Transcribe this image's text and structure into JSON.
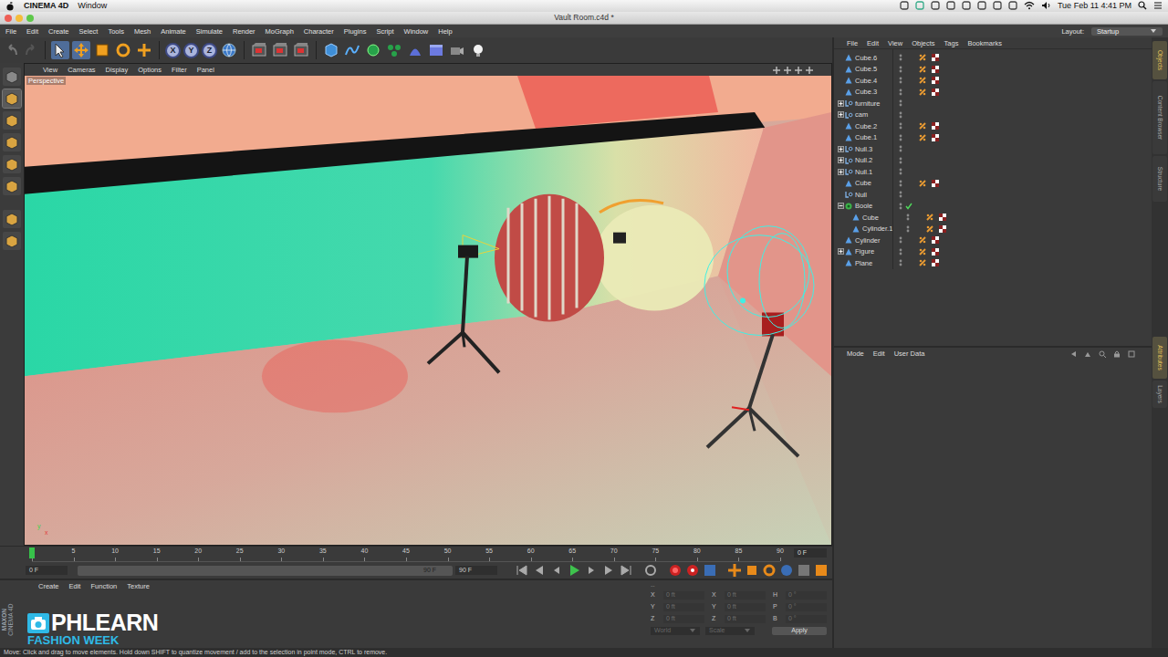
{
  "macbar": {
    "menus": [
      "CINEMA 4D",
      "Window"
    ],
    "clock": "Tue Feb 11  4:41 PM"
  },
  "window": {
    "title": "Vault Room.c4d *"
  },
  "menu": [
    "File",
    "Edit",
    "Create",
    "Select",
    "Tools",
    "Mesh",
    "Animate",
    "Simulate",
    "Render",
    "MoGraph",
    "Character",
    "Plugins",
    "Script",
    "Window",
    "Help"
  ],
  "layout": {
    "label": "Layout:",
    "value": "Startup"
  },
  "toolbar": {
    "tools": [
      {
        "selected": true
      },
      {
        "selected": true
      },
      {
        "selected": false
      },
      {
        "selected": false
      },
      {
        "selected": false
      }
    ],
    "axes": [
      {
        "label": "X",
        "on": true
      },
      {
        "label": "Y",
        "on": true
      },
      {
        "label": "Z",
        "on": true
      }
    ]
  },
  "modes": [
    {
      "selected": false
    },
    {
      "selected": true
    },
    {
      "selected": false
    },
    {
      "selected": false
    },
    {
      "selected": false
    },
    {
      "selected": false
    },
    {
      "selected": false
    },
    {
      "selected": false
    }
  ],
  "viewport": {
    "menu": [
      "View",
      "Cameras",
      "Display",
      "Options",
      "Filter",
      "Panel"
    ],
    "label": "Perspective",
    "axis": [
      "y",
      "x"
    ]
  },
  "timeline": {
    "ticks": [
      "0",
      "5",
      "10",
      "15",
      "20",
      "25",
      "30",
      "35",
      "40",
      "45",
      "50",
      "55",
      "60",
      "65",
      "70",
      "75",
      "80",
      "85",
      "90"
    ],
    "frame": "0 F",
    "playhead": 0
  },
  "transport": {
    "start": "0 F",
    "range_end": "90 F",
    "end": "90 F"
  },
  "materials": {
    "menu": [
      "Create",
      "Edit",
      "Function",
      "Texture"
    ]
  },
  "coordinates": {
    "header": "--",
    "columns": [
      {
        "axes": [
          "X",
          "Y",
          "Z"
        ],
        "values": [
          "0 ft",
          "0 ft",
          "0 ft"
        ]
      },
      {
        "axes": [
          "X",
          "Y",
          "Z"
        ],
        "values": [
          "0 ft",
          "0 ft",
          "0 ft"
        ]
      },
      {
        "axes": [
          "H",
          "P",
          "B"
        ],
        "values": [
          "0 °",
          "0 °",
          "0 °"
        ]
      }
    ],
    "mode": "World",
    "size_mode": "Scale",
    "apply": "Apply"
  },
  "objects": {
    "menu": [
      "File",
      "Edit",
      "View",
      "Objects",
      "Tags",
      "Bookmarks"
    ],
    "items": [
      {
        "name": "Cube.6",
        "kind": "object",
        "depth": 0,
        "expandable": false,
        "expanded": false,
        "checked": false,
        "tags": true
      },
      {
        "name": "Cube.5",
        "kind": "object",
        "depth": 0,
        "expandable": false,
        "expanded": false,
        "checked": false,
        "tags": true
      },
      {
        "name": "Cube.4",
        "kind": "object",
        "depth": 0,
        "expandable": false,
        "expanded": false,
        "checked": false,
        "tags": true
      },
      {
        "name": "Cube.3",
        "kind": "object",
        "depth": 0,
        "expandable": false,
        "expanded": false,
        "checked": false,
        "tags": true
      },
      {
        "name": "furniture",
        "kind": "null",
        "depth": 0,
        "expandable": true,
        "expanded": false,
        "checked": false,
        "tags": false
      },
      {
        "name": "cam",
        "kind": "null",
        "depth": 0,
        "expandable": true,
        "expanded": false,
        "checked": false,
        "tags": false
      },
      {
        "name": "Cube.2",
        "kind": "object",
        "depth": 0,
        "expandable": false,
        "expanded": false,
        "checked": false,
        "tags": true
      },
      {
        "name": "Cube.1",
        "kind": "object",
        "depth": 0,
        "expandable": false,
        "expanded": false,
        "checked": false,
        "tags": true
      },
      {
        "name": "Null.3",
        "kind": "null",
        "depth": 0,
        "expandable": true,
        "expanded": false,
        "checked": false,
        "tags": false
      },
      {
        "name": "Null.2",
        "kind": "null",
        "depth": 0,
        "expandable": true,
        "expanded": false,
        "checked": false,
        "tags": false
      },
      {
        "name": "Null.1",
        "kind": "null",
        "depth": 0,
        "expandable": true,
        "expanded": false,
        "checked": false,
        "tags": false
      },
      {
        "name": "Cube",
        "kind": "object",
        "depth": 0,
        "expandable": false,
        "expanded": false,
        "checked": false,
        "tags": true
      },
      {
        "name": "Null",
        "kind": "null",
        "depth": 0,
        "expandable": false,
        "expanded": false,
        "checked": false,
        "tags": false
      },
      {
        "name": "Boole",
        "kind": "boole",
        "depth": 0,
        "expandable": true,
        "expanded": true,
        "checked": true,
        "tags": false
      },
      {
        "name": "Cube",
        "kind": "object",
        "depth": 1,
        "expandable": false,
        "expanded": false,
        "checked": false,
        "tags": true
      },
      {
        "name": "Cylinder.1",
        "kind": "object",
        "depth": 1,
        "expandable": false,
        "expanded": false,
        "checked": false,
        "tags": true
      },
      {
        "name": "Cylinder",
        "kind": "object",
        "depth": 0,
        "expandable": false,
        "expanded": false,
        "checked": false,
        "tags": true
      },
      {
        "name": "Figure",
        "kind": "object",
        "depth": 0,
        "expandable": true,
        "expanded": false,
        "checked": false,
        "tags": true
      },
      {
        "name": "Plane",
        "kind": "object",
        "depth": 0,
        "expandable": false,
        "expanded": false,
        "checked": false,
        "tags": true
      }
    ]
  },
  "attributes": {
    "menu": [
      "Mode",
      "Edit",
      "User Data"
    ]
  },
  "side_tabs": [
    {
      "label": "Objects",
      "selected": true
    },
    {
      "label": "Content Browser",
      "selected": false
    },
    {
      "label": "Structure",
      "selected": false
    },
    {
      "label": "Attributes",
      "selected": true
    },
    {
      "label": "Layers",
      "selected": false
    }
  ],
  "status": "Move: Click and drag to move elements. Hold down SHIFT to quantize movement / add to the selection in point mode, CTRL to remove.",
  "watermark": {
    "vendor": [
      "MAXON",
      "CINEMA 4D"
    ],
    "brand": "PHLEARN",
    "sub": "FASHION WEEK"
  }
}
